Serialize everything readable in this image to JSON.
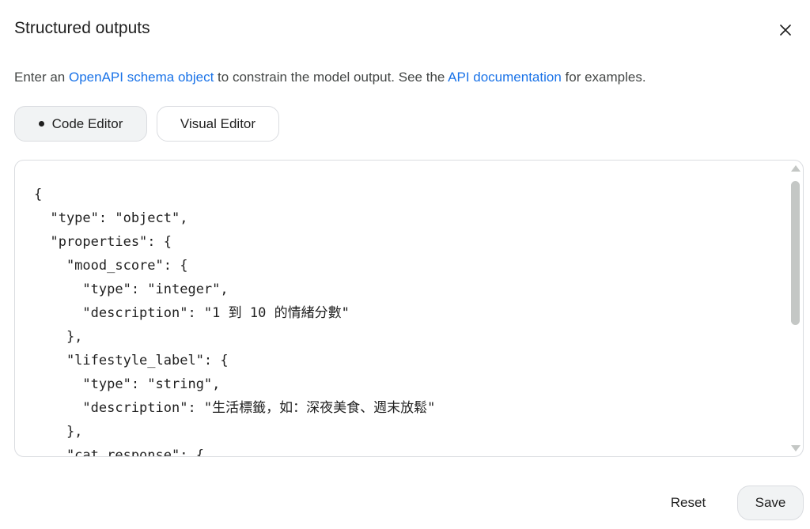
{
  "dialog": {
    "title": "Structured outputs",
    "close_icon": "close-icon"
  },
  "description": {
    "prefix": "Enter an ",
    "link1": "OpenAPI schema object",
    "middle": " to constrain the model output. See the ",
    "link2": "API documentation",
    "suffix": " for examples."
  },
  "editor_tabs": [
    {
      "label": "Code Editor",
      "selected": true
    },
    {
      "label": "Visual Editor",
      "selected": false
    }
  ],
  "code_lines": [
    "{",
    "  \"type\": \"object\",",
    "  \"properties\": {",
    "    \"mood_score\": {",
    "      \"type\": \"integer\",",
    "      \"description\": \"1 到 10 的情緒分數\"",
    "    },",
    "    \"lifestyle_label\": {",
    "      \"type\": \"string\",",
    "      \"description\": \"生活標籤，如：深夜美食、週末放鬆\"",
    "    },",
    "    \"cat_response\": {"
  ],
  "footer": {
    "reset_label": "Reset",
    "save_label": "Save"
  },
  "colors": {
    "link": "#1a73e8",
    "border": "#dadce0",
    "chip_active_bg": "#f1f3f4"
  }
}
